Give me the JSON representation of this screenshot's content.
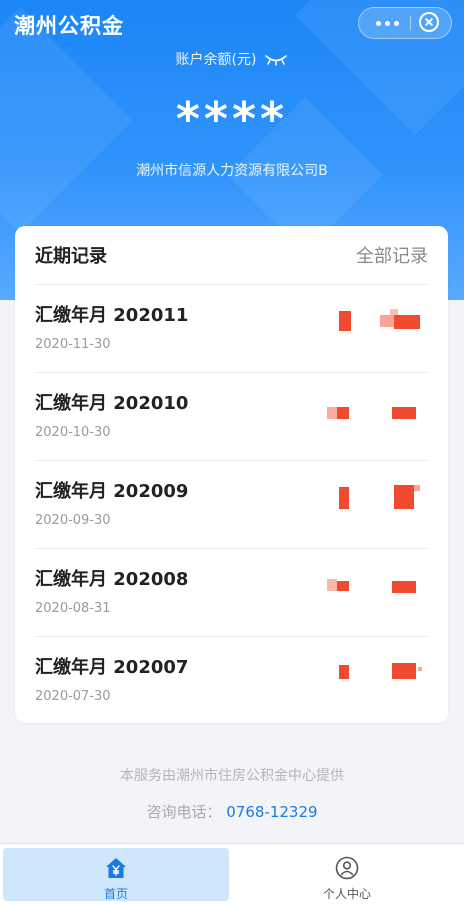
{
  "header": {
    "app_title": "潮州公积金",
    "balance_label": "账户余额(元)",
    "balance_value": "****",
    "company_name": "潮州市信源人力资源有限公司B",
    "accent_color": "#1c86f7"
  },
  "capsule": {
    "more_icon": "more-dots-icon",
    "close_icon": "close-circle-icon"
  },
  "records_card": {
    "title": "近期记录",
    "all_link": "全部记录",
    "items": [
      {
        "title": "汇缴年月 202011",
        "date": "2020-11-30"
      },
      {
        "title": "汇缴年月 202010",
        "date": "2020-10-30"
      },
      {
        "title": "汇缴年月 202009",
        "date": "2020-09-30"
      },
      {
        "title": "汇缴年月 202008",
        "date": "2020-08-31"
      },
      {
        "title": "汇缴年月 202007",
        "date": "2020-07-30"
      }
    ],
    "redaction_color": "#f24a2e"
  },
  "footer": {
    "service_note": "本服务由潮州市住房公积金中心提供",
    "phone_label": "咨询电话：",
    "phone_number": "0768-12329"
  },
  "tabbar": {
    "tabs": [
      {
        "label": "首页",
        "icon": "home-yen-icon",
        "active": true
      },
      {
        "label": "个人中心",
        "icon": "user-circle-icon",
        "active": false
      }
    ]
  }
}
